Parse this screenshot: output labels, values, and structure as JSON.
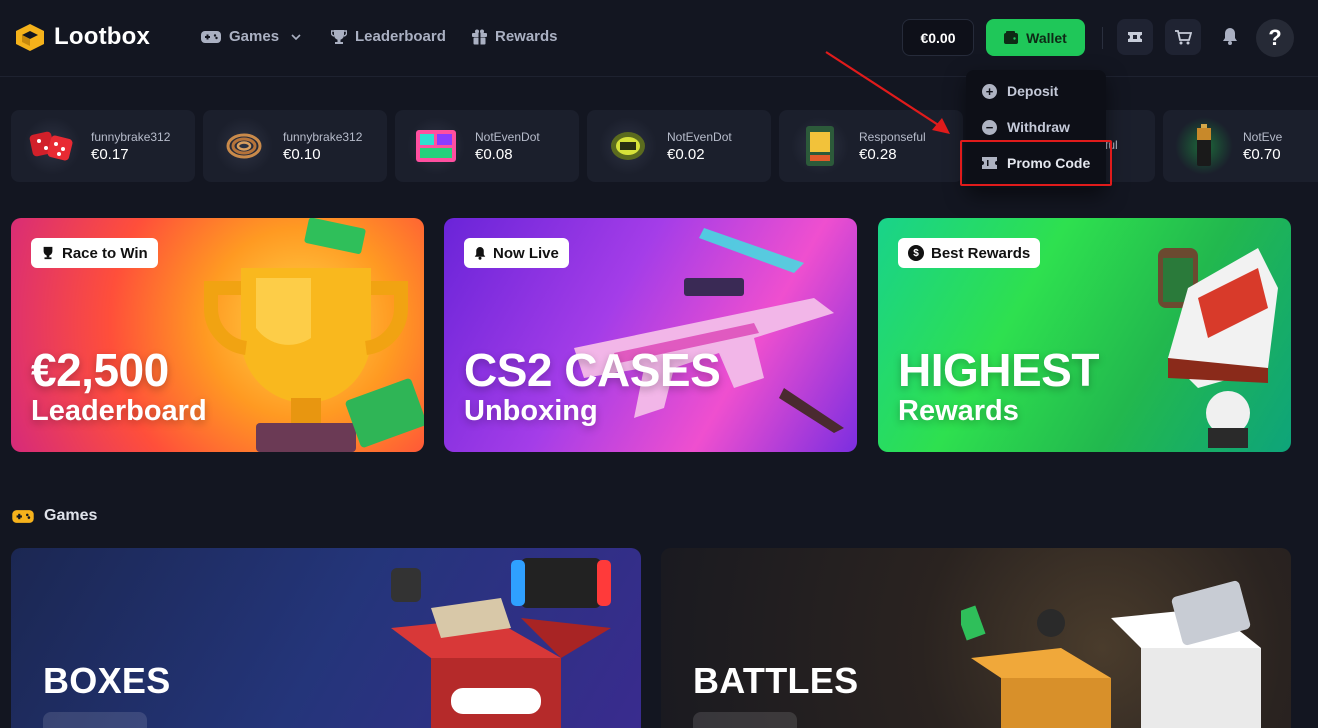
{
  "header": {
    "logo_text": "Lootbox",
    "nav": [
      {
        "label": "Games",
        "icon": "gamepad-icon"
      },
      {
        "label": "Leaderboard",
        "icon": "trophy-icon"
      },
      {
        "label": "Rewards",
        "icon": "gift-icon"
      }
    ],
    "balance": "€0.00",
    "wallet_label": "Wallet",
    "help_glyph": "?"
  },
  "wallet_menu": {
    "items": [
      {
        "label": "Deposit",
        "icon": "plus-circle-icon"
      },
      {
        "label": "Withdraw",
        "icon": "minus-circle-icon"
      },
      {
        "label": "Promo Code",
        "icon": "ticket-icon"
      }
    ]
  },
  "live_drops": [
    {
      "user": "funnybrake312",
      "price": "€0.17",
      "item": "dice"
    },
    {
      "user": "funnybrake312",
      "price": "€0.10",
      "item": "rope"
    },
    {
      "user": "NotEvenDot",
      "price": "€0.08",
      "item": "sticker"
    },
    {
      "user": "NotEvenDot",
      "price": "€0.02",
      "item": "sticker"
    },
    {
      "user": "Responseful",
      "price": "€0.28",
      "item": "card"
    },
    {
      "user": "Responseful",
      "price": "",
      "item": "hidden"
    },
    {
      "user": "NotEve",
      "price": "€0.70",
      "item": "battery"
    }
  ],
  "banners": [
    {
      "badge": "Race to Win",
      "big": "€2,500",
      "sub": "Leaderboard"
    },
    {
      "badge": "Now Live",
      "big": "CS2 CASES",
      "sub": "Unboxing"
    },
    {
      "badge": "Best Rewards",
      "big": "HIGHEST",
      "sub": "Rewards"
    }
  ],
  "games_section": {
    "title": "Games",
    "cards": [
      {
        "label": "BOXES"
      },
      {
        "label": "BATTLES"
      }
    ]
  },
  "colors": {
    "background": "#131621",
    "accent_green": "#1fc759",
    "highlight_red": "#e01b1b"
  }
}
